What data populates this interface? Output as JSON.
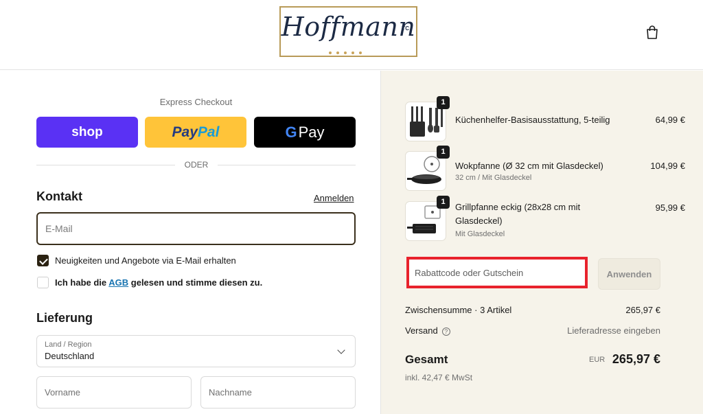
{
  "header": {
    "logo_text": "Hoffmann",
    "logo_suffix": "TC"
  },
  "express": {
    "title": "Express Checkout",
    "shop_label": "shop",
    "paypal_label_1": "Pay",
    "paypal_label_2": "Pal",
    "gpay_g": "G",
    "gpay_label": "Pay",
    "divider": "ODER"
  },
  "contact": {
    "title": "Kontakt",
    "login_link": "Anmelden",
    "email_placeholder": "E-Mail",
    "newsletter_label": "Neuigkeiten und Angebote via E-Mail erhalten",
    "newsletter_checked": true,
    "agb_prefix": "Ich habe die ",
    "agb_link": "AGB",
    "agb_suffix": " gelesen und stimme diesen zu.",
    "agb_checked": false
  },
  "delivery": {
    "title": "Lieferung",
    "country_caption": "Land / Region",
    "country_value": "Deutschland",
    "firstname_placeholder": "Vorname",
    "lastname_placeholder": "Nachname"
  },
  "cart": {
    "items": [
      {
        "name": "Küchenhelfer-Basisausstattung, 5-teilig",
        "variant": "",
        "price": "64,99 €",
        "qty": "1"
      },
      {
        "name": "Wokpfanne (Ø 32 cm mit Glasdeckel)",
        "variant": "32 cm / Mit Glasdeckel",
        "price": "104,99 €",
        "qty": "1"
      },
      {
        "name_line1": "Grillpfanne eckig (28x28 cm mit",
        "name_line2": "Glasdeckel)",
        "variant": "Mit Glasdeckel",
        "price": "95,99 €",
        "qty": "1"
      }
    ],
    "discount_placeholder": "Rabattcode oder Gutschein",
    "apply_label": "Anwenden",
    "subtotal_label": "Zwischensumme · 3 Artikel",
    "subtotal_value": "265,97 €",
    "shipping_label": "Versand",
    "shipping_value": "Lieferadresse eingeben",
    "total_label": "Gesamt",
    "total_currency": "EUR",
    "total_value": "265,97 €",
    "tax_line": "inkl. 42,47 € MwSt"
  },
  "colors": {
    "shop": "#5a31f4",
    "paypal": "#ffc439",
    "gpay": "#000000",
    "summary_bg": "#f6f3ea",
    "highlight": "#e8222c"
  }
}
